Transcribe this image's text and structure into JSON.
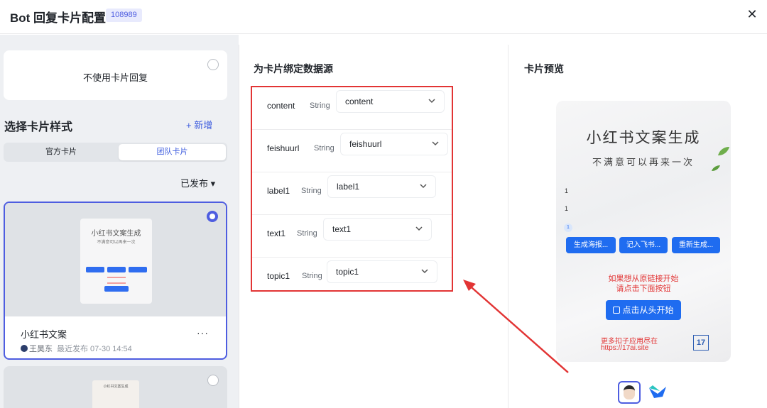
{
  "header": {
    "title": "Bot 回复卡片配置",
    "id_badge": "108989",
    "close_symbol": "✕"
  },
  "left": {
    "no_card_label": "不使用卡片回复",
    "section_title": "选择卡片样式",
    "add_label": "+ 新增",
    "tabs": [
      "官方卡片",
      "团队卡片"
    ],
    "filter_label": "已发布 ▾",
    "card1": {
      "thumb_title": "小红书文案生成",
      "thumb_subtitle": "不满意可以再来一次",
      "name": "小红书文案",
      "author": "王昊东",
      "updated": "最近发布 07-30 14:54",
      "more": "···"
    },
    "card2": {
      "thumb_title": "小红书文案生成"
    }
  },
  "middle": {
    "title": "为卡片绑定数据源",
    "rows": [
      {
        "name": "content",
        "type": "String",
        "value": "content"
      },
      {
        "name": "feishuurl",
        "type": "String",
        "value": "feishuurl"
      },
      {
        "name": "label1",
        "type": "String",
        "value": "label1"
      },
      {
        "name": "text1",
        "type": "String",
        "value": "text1"
      },
      {
        "name": "topic1",
        "type": "String",
        "value": "topic1"
      }
    ]
  },
  "right": {
    "title": "卡片预览",
    "preview": {
      "title": "小红书文案生成",
      "subtitle": "不满意可以再来一次",
      "line1": "1",
      "line2": "1",
      "badge": "1",
      "buttons": [
        "生成海报...",
        "记入飞书...",
        "重新生成..."
      ],
      "hint_line1": "如果想从原链接开始",
      "hint_line2": "请点击下面按钮",
      "main_button": "点击从头开始",
      "footer_line1": "更多扣子应用尽在",
      "footer_line2": "https://17ai.site",
      "logo_text": "17"
    }
  },
  "colors": {
    "accent": "#4e5de0",
    "highlight_border": "#e23434",
    "button_blue": "#1f6cf0"
  }
}
